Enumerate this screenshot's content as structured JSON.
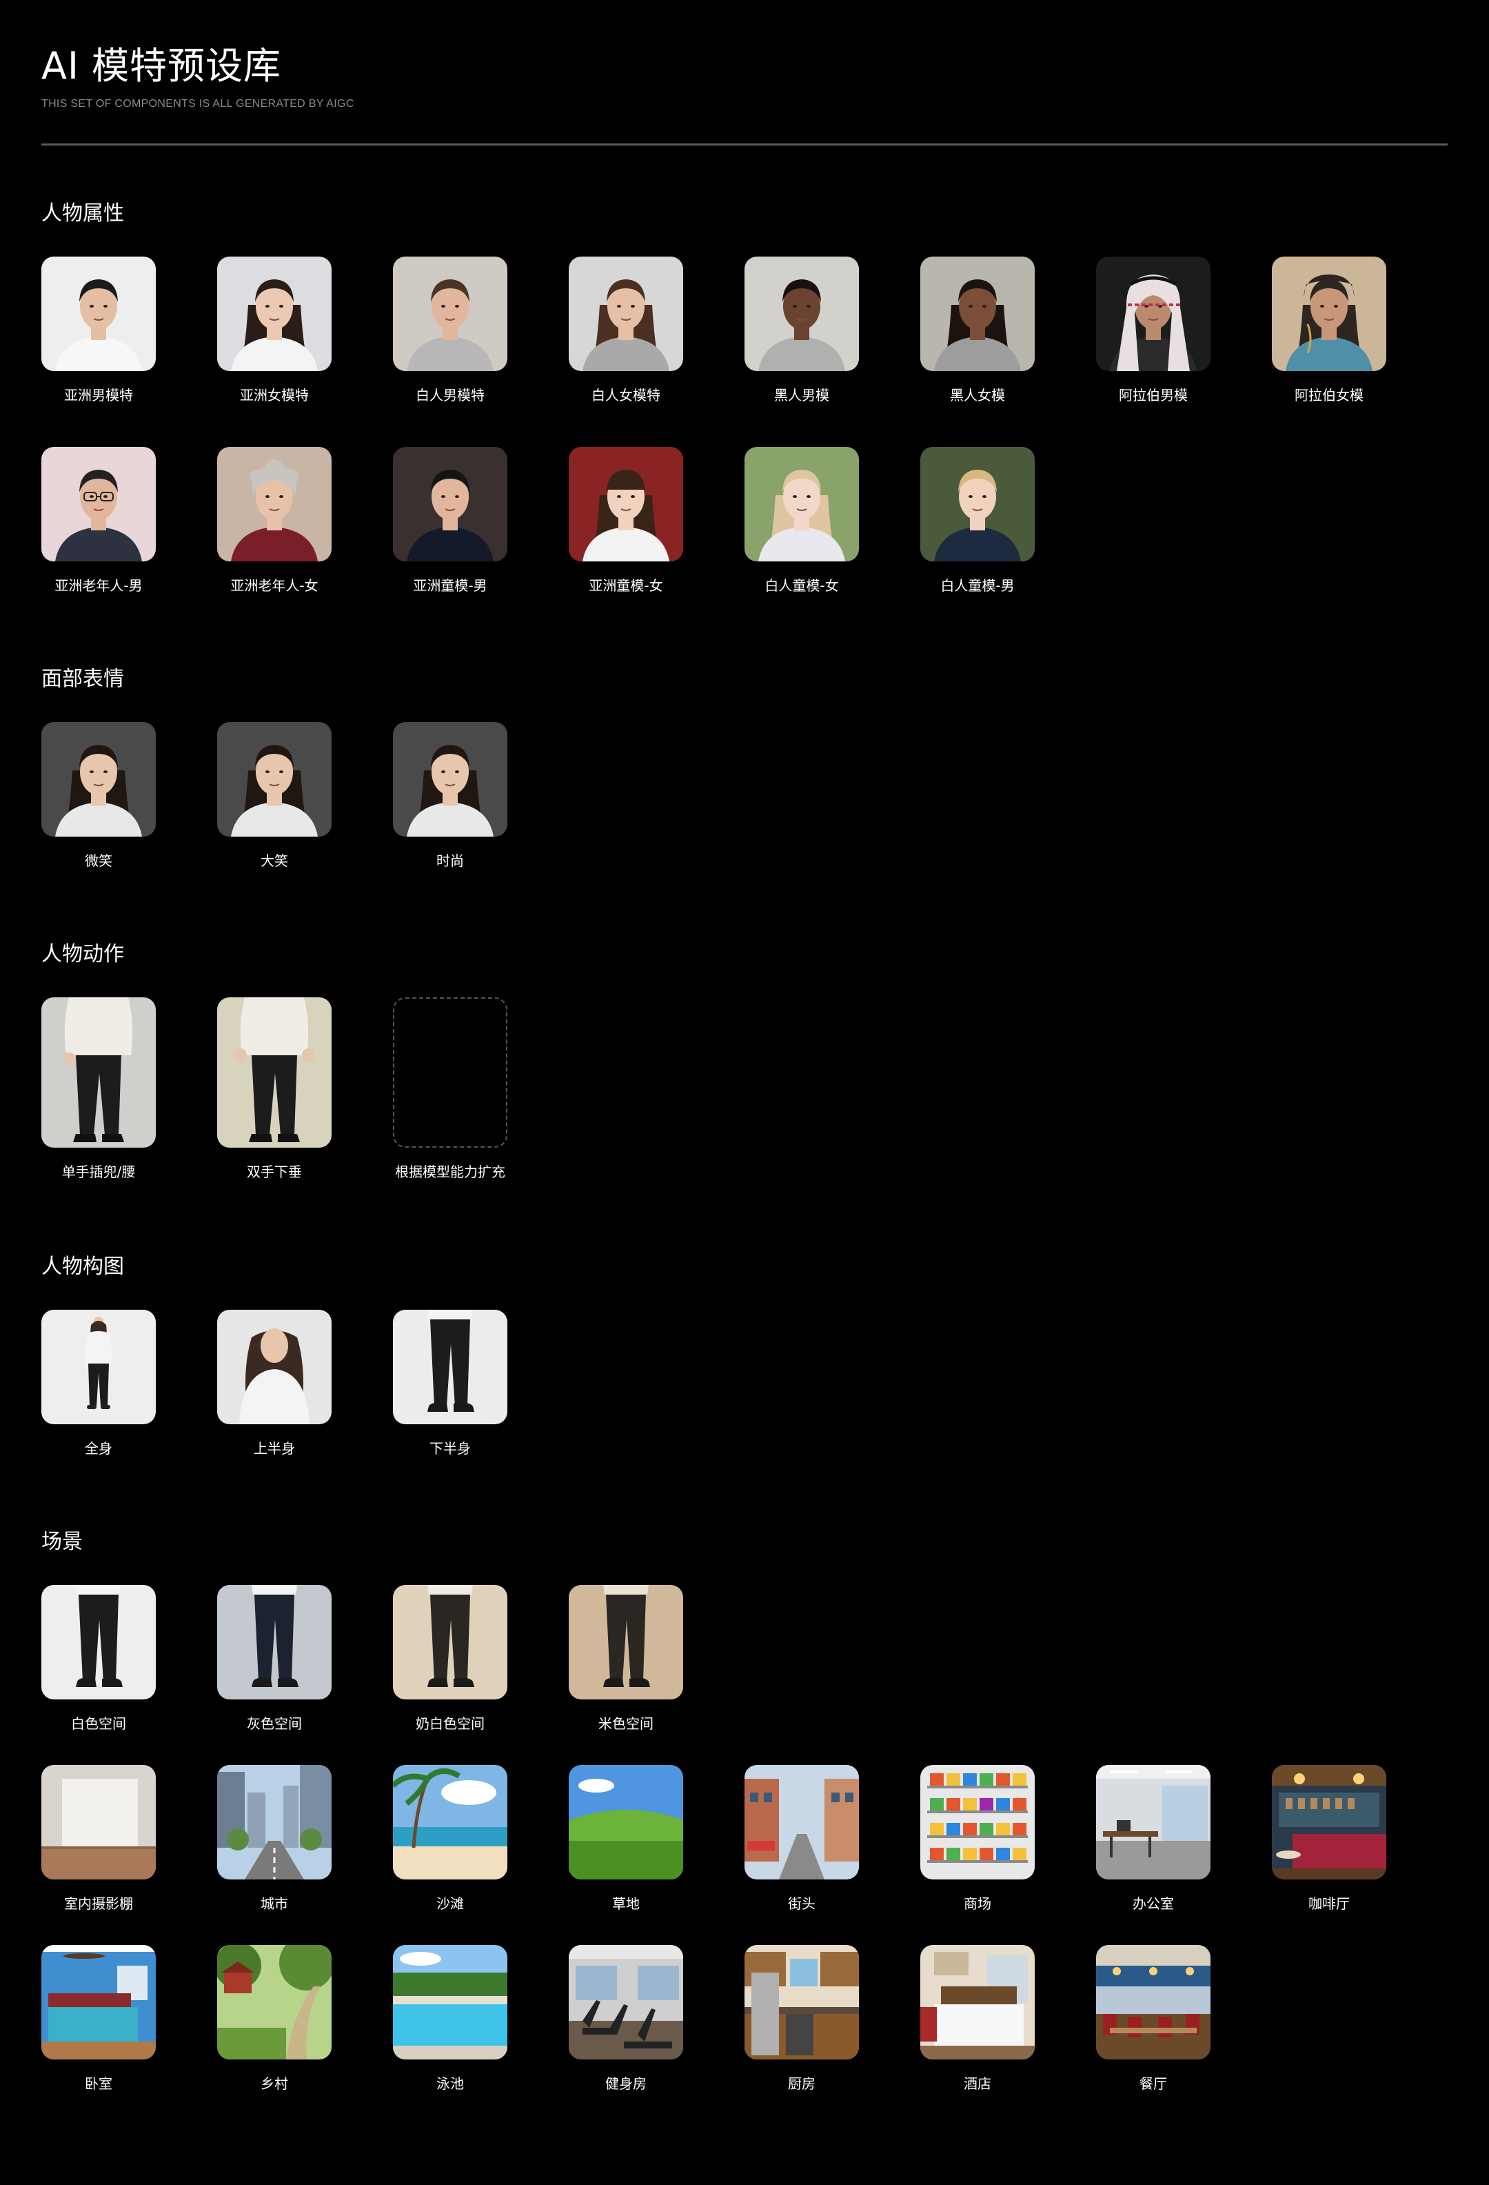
{
  "header": {
    "title": "AI 模特预设库",
    "subtitle": "THIS SET OF COMPONENTS IS ALL GENERATED BY AIGC"
  },
  "sections": {
    "attributes": {
      "title": "人物属性",
      "items": [
        "亚洲男模特",
        "亚洲女模特",
        "白人男模特",
        "白人女模特",
        "黑人男模",
        "黑人女模",
        "阿拉伯男模",
        "阿拉伯女模",
        "亚洲老年人-男",
        "亚洲老年人-女",
        "亚洲童模-男",
        "亚洲童模-女",
        "白人童模-女",
        "白人童模-男"
      ]
    },
    "expressions": {
      "title": "面部表情",
      "items": [
        "微笑",
        "大笑",
        "时尚"
      ]
    },
    "actions": {
      "title": "人物动作",
      "items": [
        "单手插兜/腰",
        "双手下垂",
        "根据模型能力扩充"
      ]
    },
    "composition": {
      "title": "人物构图",
      "items": [
        "全身",
        "上半身",
        "下半身"
      ]
    },
    "scenes": {
      "title": "场景",
      "items": [
        "白色空间",
        "灰色空间",
        "奶白色空间",
        "米色空间",
        "室内摄影棚",
        "城市",
        "沙滩",
        "草地",
        "街头",
        "商场",
        "办公室",
        "咖啡厅",
        "卧室",
        "乡村",
        "泳池",
        "健身房",
        "厨房",
        "酒店",
        "餐厅"
      ]
    }
  },
  "colors": {
    "background": "#000000",
    "text": "#ffffff",
    "subtitle": "#8a8a8a",
    "divider": "#5a5a5a"
  }
}
